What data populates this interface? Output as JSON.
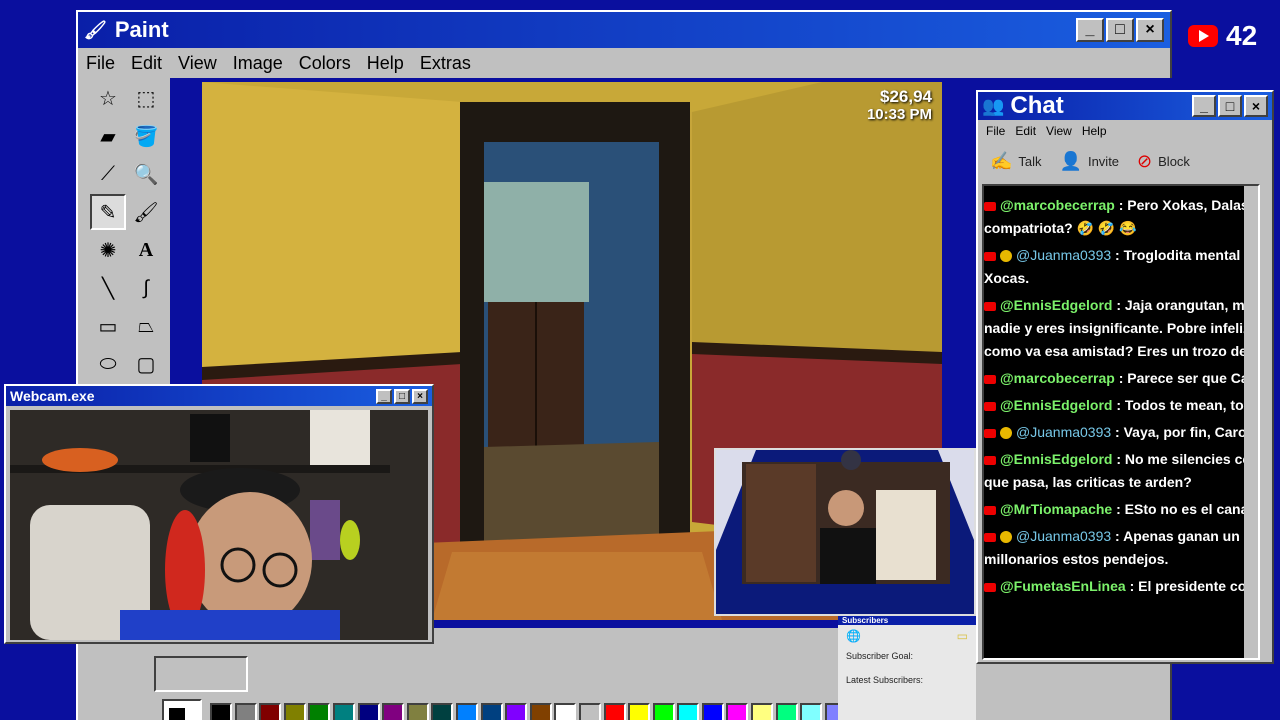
{
  "paint": {
    "title": "Paint",
    "menu": [
      "File",
      "Edit",
      "View",
      "Image",
      "Colors",
      "Help",
      "Extras"
    ],
    "window_buttons": [
      "_",
      "□",
      "×"
    ]
  },
  "game": {
    "money": "$26,94",
    "time": "10:33 PM"
  },
  "webcam": {
    "title": "Webcam.exe"
  },
  "chat": {
    "title": "Chat",
    "menu": [
      "File",
      "Edit",
      "View",
      "Help"
    ],
    "tools": [
      {
        "label": "Talk",
        "icon": "talk-icon"
      },
      {
        "label": "Invite",
        "icon": "invite-icon"
      },
      {
        "label": "Block",
        "icon": "block-icon"
      }
    ],
    "messages": [
      {
        "user": "@marcobecerrap",
        "text": " : Pero Xokas, Dalas es Esp compatriota? 🤣 🤣 😂",
        "mod": false
      },
      {
        "user": "@Juanma0393",
        "text": " : Troglodita mental y atrof Xocas.",
        "mod": true
      },
      {
        "user": "@EnnisEdgelord",
        "text": " : Jaja orangutan, mira come nadie y eres insignificante. Pobre infeliz, que le como va esa amistad? Eres un trozo de mierda c",
        "mod": false
      },
      {
        "user": "@marcobecerrap",
        "text": " : Parece ser que Cathyvipy",
        "mod": false
      },
      {
        "user": "@EnnisEdgelord",
        "text": " : Todos te mean, todos te p",
        "mod": false
      },
      {
        "user": "@Juanma0393",
        "text": " : Vaya, por fin, Carola dió u",
        "mod": true
      },
      {
        "user": "@EnnisEdgelord",
        "text": " : No me silencies como me que pasa, las criticas te arden?",
        "mod": false
      },
      {
        "user": "@MrTiomapache",
        "text": " : ESto no es el canal de Da",
        "mod": false
      },
      {
        "user": "@Juanma0393",
        "text": " : Apenas ganan un poco m millonarios estos pendejos.",
        "mod": true
      },
      {
        "user": "@FumetasEnLinea",
        "text": " : El presidente con gorra",
        "mod": false
      }
    ]
  },
  "youtube": {
    "count": "42"
  },
  "subscribers": {
    "title": "Subscribers",
    "goal_label": "Subscriber Goal:",
    "latest_label": "Latest Subscribers:"
  },
  "palette": [
    "#000000",
    "#808080",
    "#800000",
    "#808000",
    "#008000",
    "#008080",
    "#000080",
    "#800080",
    "#808040",
    "#004040",
    "#0080ff",
    "#004080",
    "#8000ff",
    "#804000",
    "#ffffff",
    "#c0c0c0",
    "#ff0000",
    "#ffff00",
    "#00ff00",
    "#00ffff",
    "#0000ff",
    "#ff00ff",
    "#ffff80",
    "#00ff80",
    "#80ffff",
    "#8080ff",
    "#ff0080",
    "#ff8040"
  ]
}
